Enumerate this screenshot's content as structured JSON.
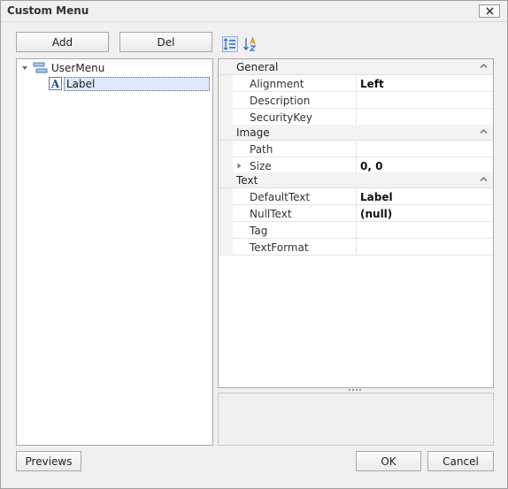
{
  "window": {
    "title": "Custom Menu"
  },
  "toolbar": {
    "add_label": "Add",
    "del_label": "Del"
  },
  "tree": {
    "root": {
      "label": "UserMenu",
      "icon": "menu-icon"
    },
    "child": {
      "label": "Label",
      "icon": "label-icon"
    }
  },
  "property_grid": {
    "sort_icons": [
      "categorized-icon",
      "alphabetical-sort-icon"
    ],
    "categories": [
      {
        "name": "General",
        "rows": [
          {
            "name": "Alignment",
            "value": "Left"
          },
          {
            "name": "Description",
            "value": ""
          },
          {
            "name": "SecurityKey",
            "value": ""
          }
        ]
      },
      {
        "name": "Image",
        "rows": [
          {
            "name": "Path",
            "value": ""
          },
          {
            "name": "Size",
            "value": "0, 0",
            "expandable": true
          }
        ]
      },
      {
        "name": "Text",
        "rows": [
          {
            "name": "DefaultText",
            "value": "Label"
          },
          {
            "name": "NullText",
            "value": "(null)"
          },
          {
            "name": "Tag",
            "value": ""
          },
          {
            "name": "TextFormat",
            "value": ""
          }
        ]
      }
    ]
  },
  "footer": {
    "previews_label": "Previews",
    "ok_label": "OK",
    "cancel_label": "Cancel"
  },
  "colors": {
    "selection": "#dde8fa",
    "accent_blue": "#3b6fc4",
    "sort_accent": "#e08a1e"
  }
}
